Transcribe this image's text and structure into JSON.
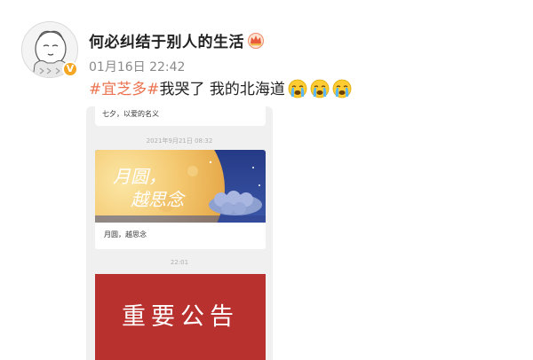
{
  "post": {
    "username": "何必纠结于别人的生活",
    "timestamp": "01月16日 22:42",
    "hashtag": "#宜芝多#",
    "body_text": "我哭了 我的北海道",
    "emojis": [
      "crying-face-icon",
      "crying-face-icon",
      "crying-face-icon"
    ],
    "username_badge": "crown-icon",
    "verified_badge": "V"
  },
  "attached_image": {
    "top_message": "七夕，以爱的名义",
    "time_1": "2021年9月21日 08:32",
    "article": {
      "banner_text_line1": "月圆，",
      "banner_text_line2": "越思念",
      "caption": "月圆，越思念"
    },
    "time_2": "22:01",
    "notice_title": "重要公告"
  },
  "colors": {
    "hashtag": "#eb7350",
    "username": "#222222",
    "timestamp": "#8a8a8a",
    "notice_bg": "#b8312f",
    "verified": "#f5a623"
  }
}
